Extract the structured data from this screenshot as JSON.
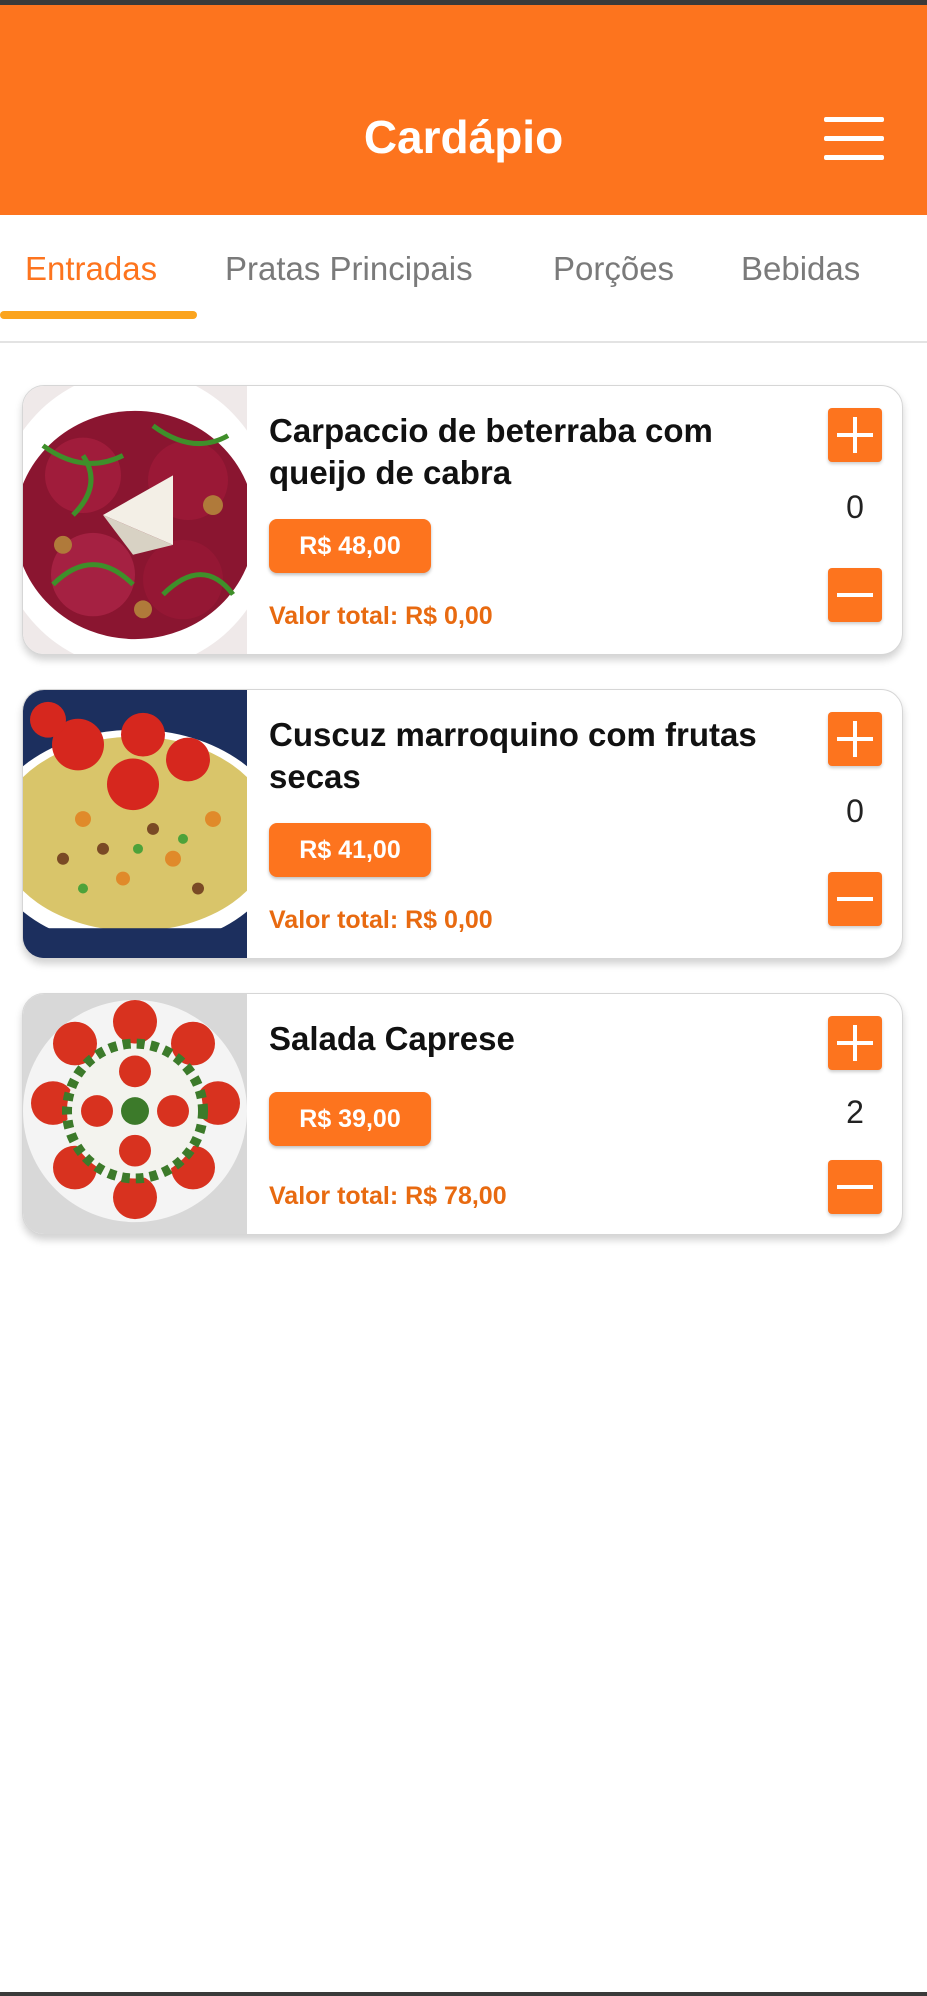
{
  "app_bar": {
    "title": "Cardápio",
    "menu_icon": "hamburger-menu-icon",
    "color": "#fd741e"
  },
  "tabs": [
    {
      "label": "Entradas",
      "active": true
    },
    {
      "label": "Pratas Principais",
      "active": false
    },
    {
      "label": "Porções",
      "active": false
    },
    {
      "label": "Bebidas",
      "active": false
    }
  ],
  "items": [
    {
      "name": "Carpaccio de beterraba com queijo de cabra",
      "price": "R$ 48,00",
      "total": "Valor total: R$ 0,00",
      "quantity": "0",
      "image": "beet-carpaccio-photo"
    },
    {
      "name": "Cuscuz marroquino com frutas secas",
      "price": "R$ 41,00",
      "total": "Valor total: R$ 0,00",
      "quantity": "0",
      "image": "couscous-photo"
    },
    {
      "name": "Salada Caprese",
      "price": "R$ 39,00",
      "total": "Valor total: R$ 78,00",
      "quantity": "2",
      "image": "caprese-salad-photo"
    }
  ],
  "colors": {
    "accent": "#fd741e",
    "tab_indicator": "#fba41e",
    "total_text": "#e86a10",
    "inactive_tab": "#7a7a7a"
  }
}
